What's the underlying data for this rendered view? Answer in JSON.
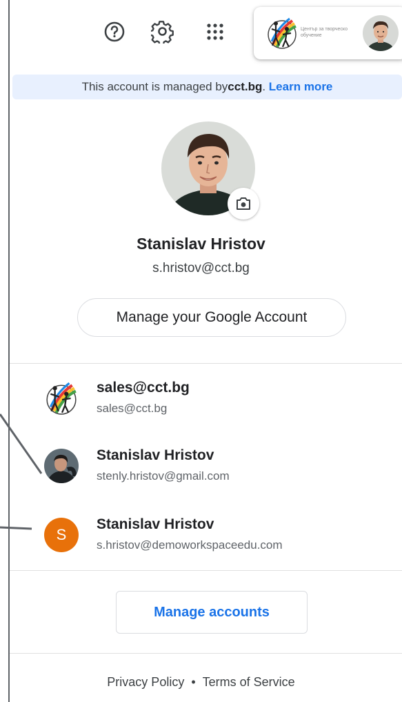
{
  "topbar": {
    "icons": [
      "help-icon",
      "gear-icon",
      "apps-grid-icon"
    ],
    "org_logo_text": "Център за творческо обучение"
  },
  "banner": {
    "prefix": "This account is managed by ",
    "domain": "cct.bg",
    "suffix": ". ",
    "link": "Learn more"
  },
  "profile": {
    "name": "Stanislav Hristov",
    "email": "s.hristov@cct.bg",
    "manage_button": "Manage your Google Account"
  },
  "accounts": [
    {
      "name": "sales@cct.bg",
      "email": "sales@cct.bg",
      "avatar": "org-logo"
    },
    {
      "name": "Stanislav Hristov",
      "email": "stenly.hristov@gmail.com",
      "avatar": "photo"
    },
    {
      "name": "Stanislav Hristov",
      "email": "s.hristov@demoworkspaceedu.com",
      "avatar": "letter",
      "letter": "S"
    }
  ],
  "manage_accounts_label": "Manage accounts",
  "footer": {
    "privacy": "Privacy Policy",
    "separator": "•",
    "terms": "Terms of Service"
  },
  "colors": {
    "accent": "#1a73e8",
    "banner_bg": "#e8f0fe",
    "letter_avatar": "#e8710a"
  }
}
